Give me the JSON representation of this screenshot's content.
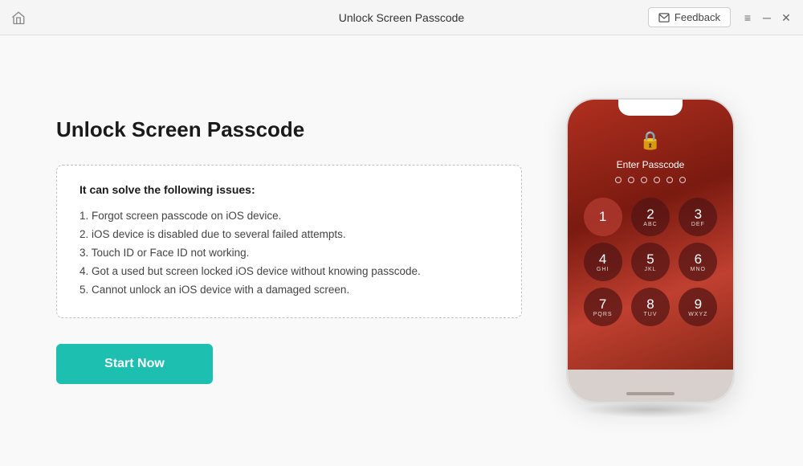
{
  "titlebar": {
    "title": "Unlock Screen Passcode",
    "feedback_label": "Feedback"
  },
  "window_controls": {
    "menu_icon": "≡",
    "minimize_icon": "─",
    "close_icon": "✕"
  },
  "main": {
    "page_title": "Unlock Screen Passcode",
    "issues_heading": "It can solve the following issues:",
    "issues": [
      "1. Forgot screen passcode on iOS device.",
      "2. iOS device is disabled due to several failed attempts.",
      "3. Touch ID or Face ID not working.",
      "4. Got a used but screen locked iOS device without knowing passcode.",
      "5. Cannot unlock an iOS device with a damaged screen."
    ],
    "start_button_label": "Start Now"
  },
  "phone": {
    "enter_passcode_text": "Enter Passcode",
    "dots_count": 6,
    "numpad": [
      {
        "main": "1",
        "sub": ""
      },
      {
        "main": "2",
        "sub": "ABC"
      },
      {
        "main": "3",
        "sub": "DEF"
      },
      {
        "main": "4",
        "sub": "GHI"
      },
      {
        "main": "5",
        "sub": "JKL"
      },
      {
        "main": "6",
        "sub": "MNO"
      },
      {
        "main": "7",
        "sub": "PQRS"
      },
      {
        "main": "8",
        "sub": "TUV"
      },
      {
        "main": "9",
        "sub": "WXYZ"
      }
    ]
  }
}
